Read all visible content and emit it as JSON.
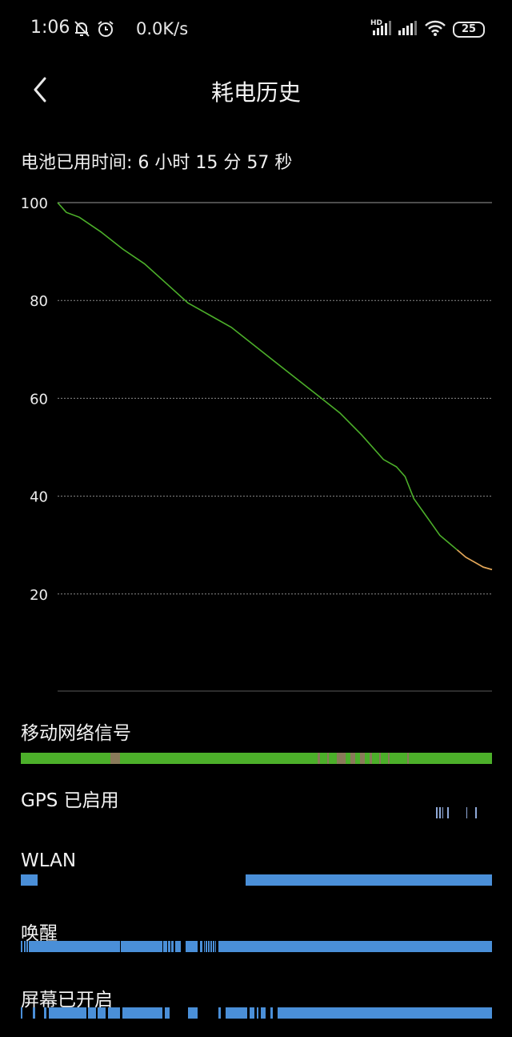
{
  "status_bar": {
    "time": "1:06",
    "net_speed": "0.0K/s",
    "hd_label": "HD",
    "battery": "25",
    "icons": [
      "mute-bell-icon",
      "alarm-icon",
      "signal-icon",
      "signal-icon",
      "wifi-icon",
      "battery-icon"
    ]
  },
  "header": {
    "title": "耗电历史",
    "back_icon": "chevron-left-icon"
  },
  "usage_text": "电池已用时间: 6 小时 15 分 57 秒",
  "chart_data": {
    "type": "line",
    "title": "",
    "xlabel": "",
    "ylabel": "",
    "ylim": [
      0,
      100
    ],
    "y_ticks": [
      "100",
      "80",
      "60",
      "40",
      "20"
    ],
    "grid": true,
    "series": [
      {
        "color": "#4caf2a",
        "x": [
          0,
          0.02,
          0.05,
          0.1,
          0.15,
          0.2,
          0.25,
          0.3,
          0.35,
          0.4,
          0.45,
          0.5,
          0.55,
          0.6,
          0.65,
          0.7,
          0.75,
          0.78,
          0.8,
          0.82,
          0.84,
          0.86,
          0.88,
          0.9,
          0.92,
          0.94,
          0.96,
          0.98,
          1.0
        ],
        "y": [
          100,
          98,
          97,
          94,
          90.5,
          87.5,
          83.5,
          79.5,
          77,
          74.5,
          71,
          67.5,
          64,
          60.5,
          57,
          52.5,
          47.5,
          46,
          44,
          39.5,
          37,
          34.5,
          32,
          30.5,
          29,
          27.5,
          26.5,
          25.5,
          25
        ]
      }
    ],
    "end_color": "#e8a05a"
  },
  "colors": {
    "accent_green": "#4caf2a",
    "bar_blue": "#4a8fd8",
    "signal_weak": "#8a7a5a",
    "grid": "#8a8a8a"
  },
  "bars": [
    {
      "label": "移动网络信号",
      "kind": "signal",
      "segments": [
        [
          0,
          1
        ]
      ],
      "weak": [
        [
          0.19,
          0.21
        ],
        [
          0.63,
          0.635
        ],
        [
          0.65,
          0.653
        ],
        [
          0.67,
          0.69
        ],
        [
          0.7,
          0.71
        ],
        [
          0.72,
          0.73
        ],
        [
          0.74,
          0.745
        ],
        [
          0.76,
          0.764
        ],
        [
          0.78,
          0.783
        ],
        [
          0.82,
          0.823
        ]
      ]
    },
    {
      "label": "GPS 已启用",
      "kind": "ticks",
      "segments": [
        [
          0.882,
          0.884
        ],
        [
          0.888,
          0.89
        ],
        [
          0.894,
          0.897
        ],
        [
          0.905,
          0.908
        ],
        [
          0.945,
          0.948
        ],
        [
          0.965,
          0.967
        ]
      ]
    },
    {
      "label": "WLAN",
      "kind": "blue",
      "segments": [
        [
          0,
          0.035
        ],
        [
          0.477,
          1
        ]
      ]
    },
    {
      "label": "唤醒",
      "kind": "blue",
      "segments": [
        [
          0,
          0.004
        ],
        [
          0.006,
          0.01
        ],
        [
          0.012,
          0.014
        ],
        [
          0.017,
          0.21
        ],
        [
          0.212,
          0.3
        ],
        [
          0.303,
          0.31
        ],
        [
          0.313,
          0.318
        ],
        [
          0.32,
          0.324
        ],
        [
          0.327,
          0.34
        ],
        [
          0.35,
          0.375
        ],
        [
          0.38,
          0.385
        ],
        [
          0.388,
          0.39
        ],
        [
          0.392,
          0.395
        ],
        [
          0.398,
          0.4
        ],
        [
          0.403,
          0.405
        ],
        [
          0.408,
          0.41
        ],
        [
          0.412,
          0.415
        ],
        [
          0.42,
          1
        ]
      ]
    },
    {
      "label": "屏幕已开启",
      "kind": "blue",
      "segments": [
        [
          0,
          0.003
        ],
        [
          0.025,
          0.03
        ],
        [
          0.05,
          0.055
        ],
        [
          0.06,
          0.14
        ],
        [
          0.143,
          0.16
        ],
        [
          0.163,
          0.18
        ],
        [
          0.185,
          0.21
        ],
        [
          0.215,
          0.3
        ],
        [
          0.305,
          0.315
        ],
        [
          0.355,
          0.375
        ],
        [
          0.42,
          0.425
        ],
        [
          0.435,
          0.48
        ],
        [
          0.485,
          0.495
        ],
        [
          0.5,
          0.505
        ],
        [
          0.51,
          0.52
        ],
        [
          0.53,
          0.535
        ],
        [
          0.545,
          1
        ]
      ]
    }
  ]
}
